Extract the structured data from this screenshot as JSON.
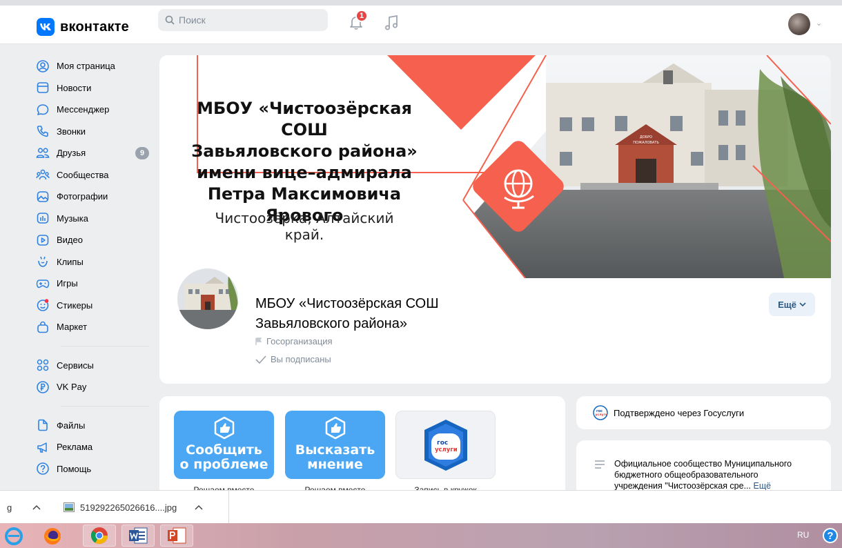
{
  "header": {
    "logo_mark": "K",
    "logo_text": "вконтакте",
    "search_placeholder": "Поиск",
    "notifications_count": "1"
  },
  "sidebar": {
    "items": [
      {
        "label": "Моя страница",
        "icon": "user-circle-icon"
      },
      {
        "label": "Новости",
        "icon": "news-icon"
      },
      {
        "label": "Мессенджер",
        "icon": "message-icon"
      },
      {
        "label": "Звонки",
        "icon": "phone-icon"
      },
      {
        "label": "Друзья",
        "icon": "friends-icon",
        "badge": "9"
      },
      {
        "label": "Сообщества",
        "icon": "communities-icon"
      },
      {
        "label": "Фотографии",
        "icon": "photo-icon"
      },
      {
        "label": "Музыка",
        "icon": "music-icon"
      },
      {
        "label": "Видео",
        "icon": "video-icon"
      },
      {
        "label": "Клипы",
        "icon": "clips-icon"
      },
      {
        "label": "Игры",
        "icon": "gamepad-icon"
      },
      {
        "label": "Стикеры",
        "icon": "sticker-icon"
      },
      {
        "label": "Маркет",
        "icon": "market-icon"
      }
    ],
    "items2": [
      {
        "label": "Сервисы",
        "icon": "services-icon"
      },
      {
        "label": "VK Pay",
        "icon": "vkpay-icon"
      }
    ],
    "items3": [
      {
        "label": "Файлы",
        "icon": "file-icon"
      },
      {
        "label": "Реклама",
        "icon": "megaphone-icon"
      },
      {
        "label": "Помощь",
        "icon": "help-icon"
      }
    ]
  },
  "cover": {
    "title_lines": [
      "МБОУ «Чистоозёрская СОШ",
      "Завьяловского района»",
      "имени вице–адмирала",
      "Петра Максимовича Ярового"
    ],
    "subtitle": "Чистоозёрка, Алтайский край.",
    "building_sign_1": "ДОБРО",
    "building_sign_2": "ПОЖАЛОВАТЬ"
  },
  "group": {
    "name_line1": "МБОУ «Чистоозёрская СОШ",
    "name_line2": "Завьяловского района»",
    "type": "Госорганизация",
    "subscribed": "Вы подписаны",
    "more_button": "Ещё"
  },
  "widgets": [
    {
      "title_line1": "Сообщить",
      "title_line2": "о проблеме",
      "caption": "Решаем вместе"
    },
    {
      "title_line1": "Высказать",
      "title_line2": "мнение",
      "caption": "Решаем вместе"
    },
    {
      "badge_line1": "гос",
      "badge_line2": "услуги",
      "caption": "Запись в кружок"
    }
  ],
  "verify": {
    "text": "Подтверждено через Госуслуги",
    "logo_line1": "гос",
    "logo_line2": "услуги"
  },
  "description": {
    "line1": "Официальное сообщество Муниципального",
    "line2": "бюджетного общеобразовательного",
    "line3": "учреждения \"Чистоозёрская сре...",
    "more": "Ещё"
  },
  "downloads": {
    "left_fragment": "g",
    "file_name": "519292265026616....jpg"
  },
  "taskbar": {
    "lang": "RU",
    "help": "?",
    "apps": [
      "ie-icon",
      "firefox-icon",
      "chrome-icon",
      "word-icon",
      "powerpoint-icon"
    ]
  },
  "colors": {
    "accent": "#0077ff",
    "cover_red": "#f5614e",
    "widget_blue": "#4ba7f3",
    "link": "#2a5885"
  }
}
